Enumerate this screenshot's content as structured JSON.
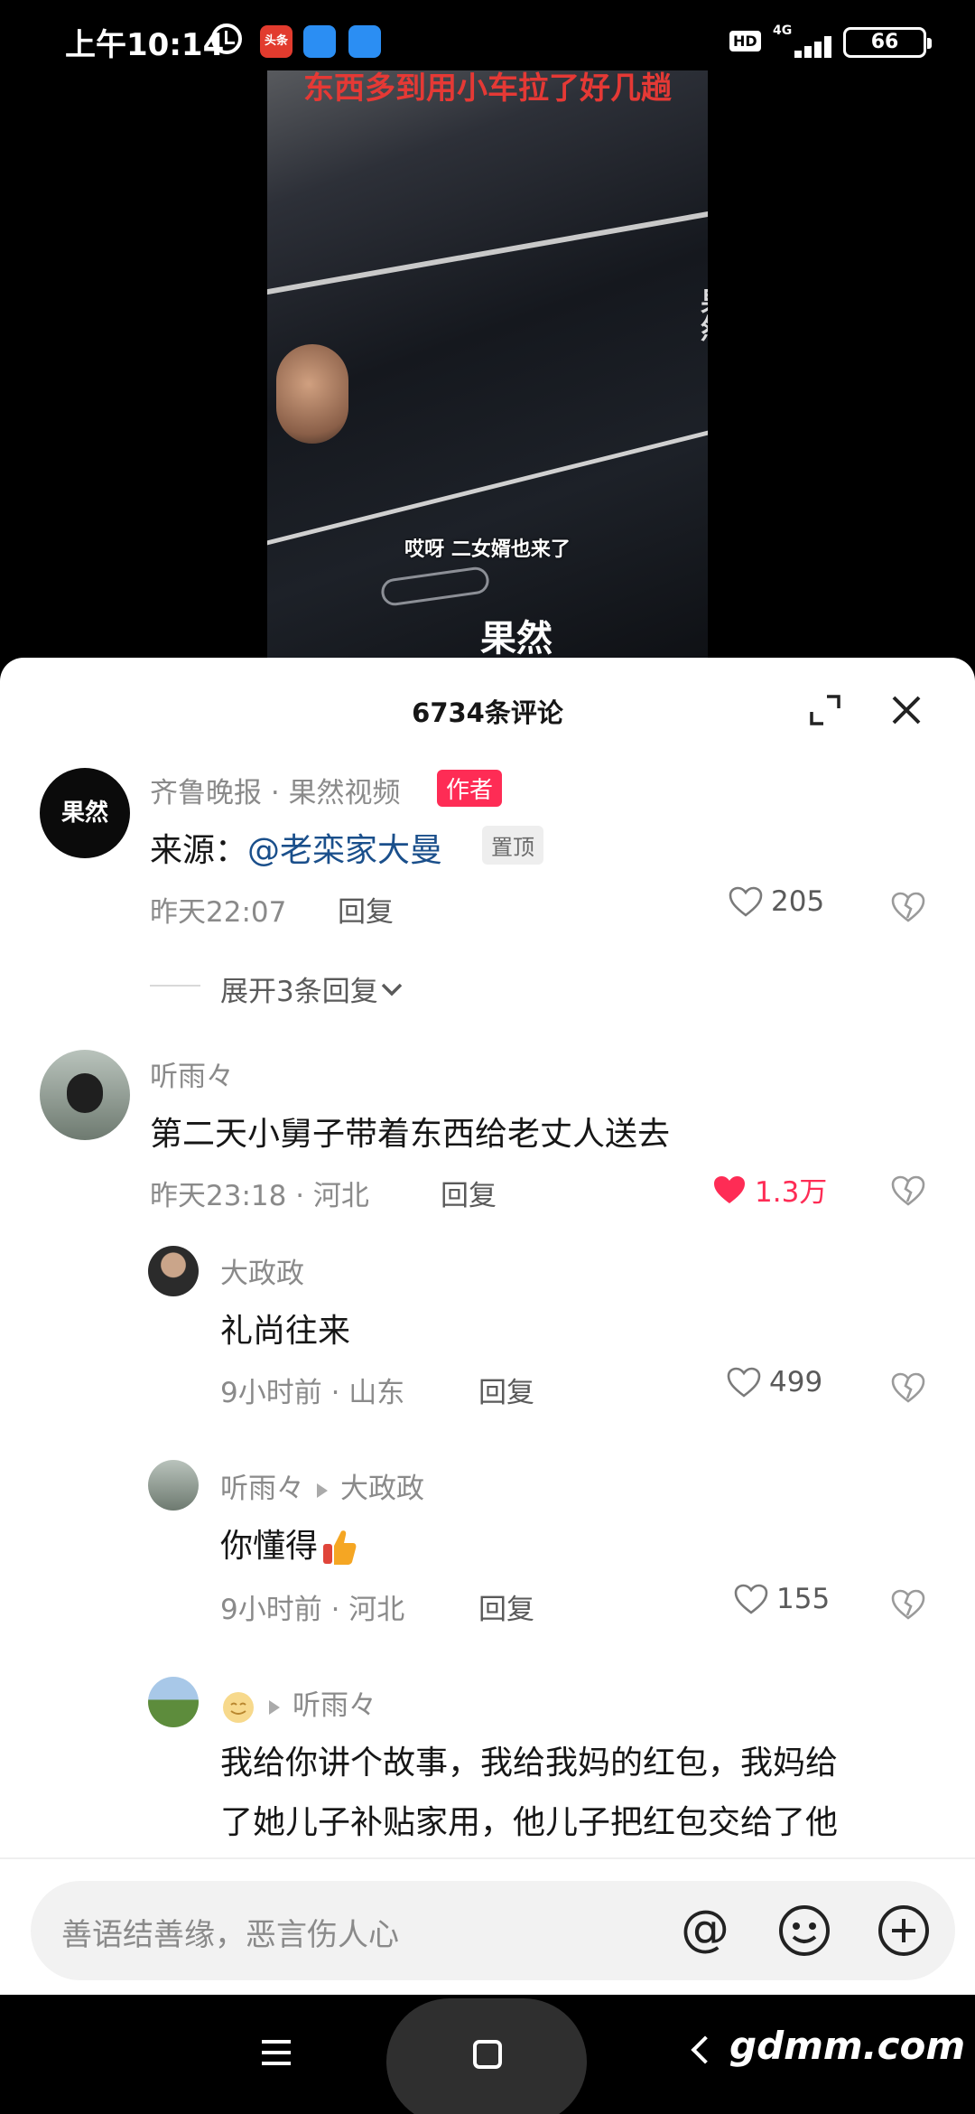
{
  "status_bar": {
    "time": "上午10:14",
    "app_badge": "头条",
    "hd": "HD",
    "network": "4G",
    "battery": "66"
  },
  "video": {
    "top_caption": "东西多到用小车拉了好几趟",
    "subtitle": "哎呀 二女婿也来了",
    "watermark": "果然"
  },
  "sheet": {
    "title": "6734条评论"
  },
  "comments": [
    {
      "author": "齐鲁晚报 · 果然视频",
      "badge": "作者",
      "avatar_text": "果然",
      "text_prefix": "来源：",
      "mention": "@老栾家大曼",
      "pin": "置顶",
      "time": "昨天22:07",
      "reply_label": "回复",
      "likes": "205",
      "expand": "展开3条回复"
    },
    {
      "author": "听雨々",
      "text": "第二天小舅子带着东西给老丈人送去",
      "time": "昨天23:18 · 河北",
      "reply_label": "回复",
      "likes": "1.3万",
      "replies": [
        {
          "author": "大政政",
          "text": "礼尚往来",
          "time": "9小时前 · 山东",
          "reply_label": "回复",
          "likes": "499"
        },
        {
          "author": "听雨々",
          "to": "大政政",
          "text": "你懂得",
          "time": "9小时前 · 河北",
          "reply_label": "回复",
          "likes": "155"
        },
        {
          "author": "",
          "to": "听雨々",
          "text_line1": "我给你讲个故事，我给我妈的红包，我妈给",
          "text_line2": "了她儿子补贴家用，他儿子把红包交给了他"
        }
      ]
    }
  ],
  "input": {
    "placeholder": "善语结善缘，恶言伤人心",
    "at_icon": "@"
  },
  "nav": {
    "brand": "gdmm.com"
  },
  "colors": {
    "accent": "#fe2c55",
    "mention": "#1a4f8b",
    "liked_heart": "#fe2c55"
  }
}
